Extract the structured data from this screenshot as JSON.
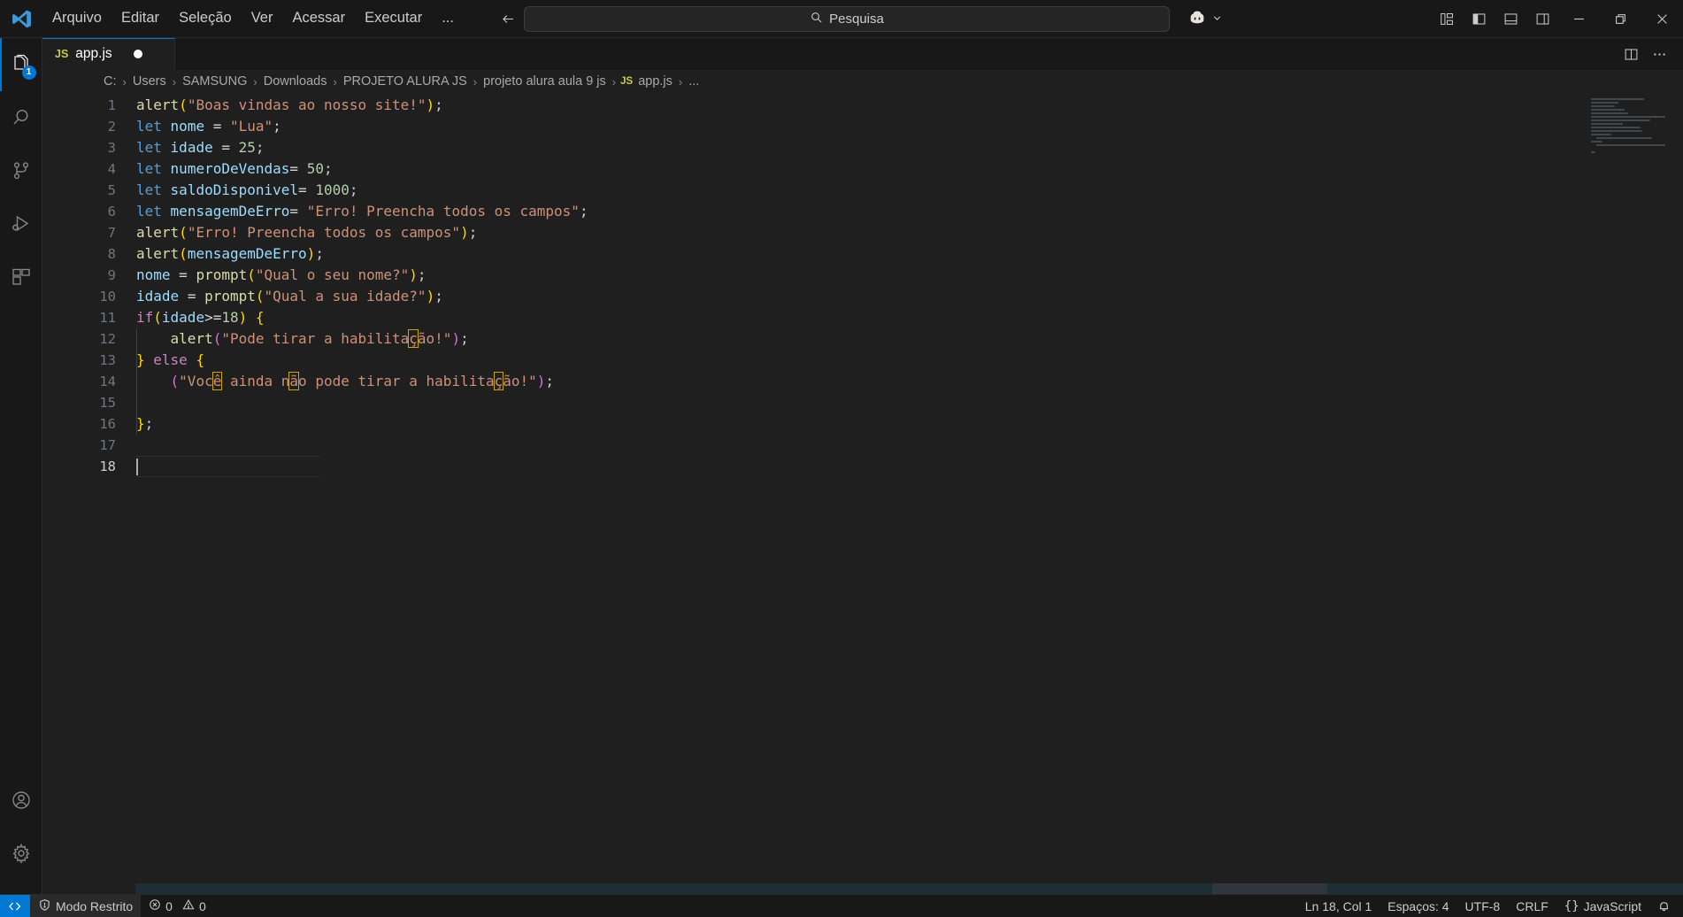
{
  "app": {
    "accent": "#0078d4",
    "bg": "#1f1f1f",
    "chrome_bg": "#181818"
  },
  "titlebar": {
    "logo_name": "vscode-logo",
    "menu": [
      {
        "label": "Arquivo",
        "name": "menu-arquivo"
      },
      {
        "label": "Editar",
        "name": "menu-editar"
      },
      {
        "label": "Seleção",
        "name": "menu-selecao"
      },
      {
        "label": "Ver",
        "name": "menu-ver"
      },
      {
        "label": "Acessar",
        "name": "menu-acessar"
      },
      {
        "label": "Executar",
        "name": "menu-executar"
      },
      {
        "label": "...",
        "name": "menu-more"
      }
    ],
    "nav": {
      "back": "back-arrow",
      "forward": "forward-arrow"
    },
    "search": {
      "placeholder": "Pesquisa",
      "value": ""
    },
    "copilot": {
      "label": "copilot-icon",
      "chevron": "chevron-down-icon"
    },
    "layout_icons": [
      "customize-layout-icon",
      "toggle-primary-sidebar-icon",
      "toggle-panel-icon",
      "toggle-secondary-sidebar-icon"
    ],
    "window_controls": {
      "minimize": "—",
      "restore": "❐",
      "close": "✕"
    }
  },
  "activitybar": {
    "top": [
      {
        "name": "activity-explorer",
        "icon": "files-icon",
        "active": true,
        "badge": "1"
      },
      {
        "name": "activity-search",
        "icon": "search-icon",
        "active": false,
        "badge": ""
      },
      {
        "name": "activity-source-control",
        "icon": "source-control-icon",
        "active": false,
        "badge": ""
      },
      {
        "name": "activity-run-debug",
        "icon": "run-and-debug-icon",
        "active": false,
        "badge": ""
      },
      {
        "name": "activity-extensions",
        "icon": "extensions-icon",
        "active": false,
        "badge": ""
      }
    ],
    "bottom": [
      {
        "name": "activity-account",
        "icon": "account-icon"
      },
      {
        "name": "activity-manage",
        "icon": "gear-icon"
      }
    ]
  },
  "tabs": [
    {
      "label": "app.js",
      "icon_text": "JS",
      "dirty": true,
      "active": true
    }
  ],
  "tab_actions": [
    {
      "name": "split-editor-right-button",
      "icon": "split-editor-icon"
    },
    {
      "name": "more-editor-actions-button",
      "icon": "ellipsis-icon"
    }
  ],
  "breadcrumb": {
    "items": [
      "C:",
      "Users",
      "SAMSUNG",
      "Downloads",
      "PROJETO ALURA JS",
      "projeto alura aula 9 js",
      "app.js",
      "..."
    ],
    "file_icon_text": "JS",
    "separator": "›"
  },
  "editor": {
    "line_count": 18,
    "active_line": 18,
    "lines": [
      {
        "n": 1,
        "text": "alert(\"Boas vindas ao nosso site!\");"
      },
      {
        "n": 2,
        "text": "let nome = \"Lua\";"
      },
      {
        "n": 3,
        "text": "let idade = 25;"
      },
      {
        "n": 4,
        "text": "let numeroDeVendas= 50;"
      },
      {
        "n": 5,
        "text": "let saldoDisponivel= 1000;"
      },
      {
        "n": 6,
        "text": "let mensagemDeErro= \"Erro! Preencha todos os campos\";"
      },
      {
        "n": 7,
        "text": "alert(\"Erro! Preencha todos os campos\");"
      },
      {
        "n": 8,
        "text": "alert(mensagemDeErro);"
      },
      {
        "n": 9,
        "text": "nome = prompt(\"Qual o seu nome?\");"
      },
      {
        "n": 10,
        "text": "idade = prompt(\"Qual a sua idade?\");"
      },
      {
        "n": 11,
        "text": "if(idade>=18) {"
      },
      {
        "n": 12,
        "text": "    alert(\"Pode tirar a habilitação!\");"
      },
      {
        "n": 13,
        "text": "} else {"
      },
      {
        "n": 14,
        "text": "    (\"Você ainda não pode tirar a habilitação!\");"
      },
      {
        "n": 15,
        "text": ""
      },
      {
        "n": 16,
        "text": "};"
      },
      {
        "n": 17,
        "text": ""
      },
      {
        "n": 18,
        "text": ""
      }
    ]
  },
  "statusbar": {
    "remote_icon": "remote-window-icon",
    "left": [
      {
        "name": "restricted-mode",
        "icon": "shield-icon",
        "label": "Modo Restrito"
      },
      {
        "name": "problems",
        "icon": "error-warning-icons",
        "label": "0  0",
        "errors": "0",
        "warnings": "0"
      }
    ],
    "right": [
      {
        "name": "editor-position",
        "label": "Ln 18, Col 1"
      },
      {
        "name": "editor-indentation",
        "label": "Espaços: 4"
      },
      {
        "name": "editor-encoding",
        "label": "UTF-8"
      },
      {
        "name": "editor-eol",
        "label": "CRLF"
      },
      {
        "name": "editor-language",
        "label": "JavaScript",
        "icon": "braces-icon"
      },
      {
        "name": "notifications",
        "label": "",
        "icon": "bell-icon"
      }
    ]
  }
}
